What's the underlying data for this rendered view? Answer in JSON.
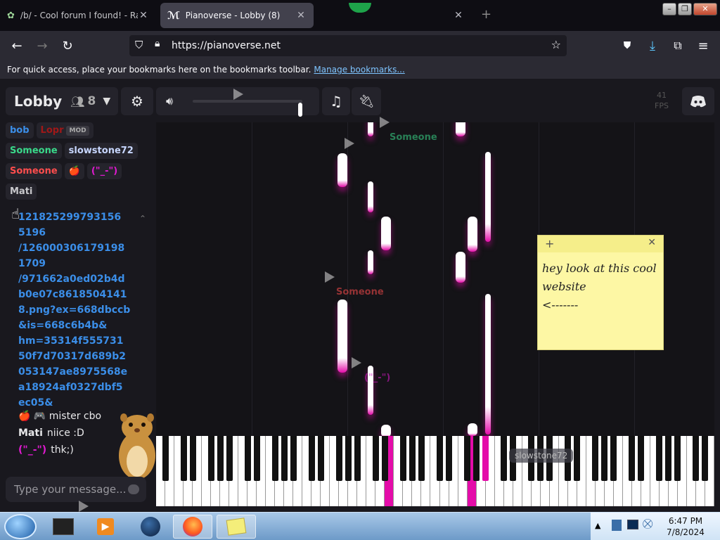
{
  "browser": {
    "tabs": [
      {
        "title": "/b/ - Cool forum I found! - Ran",
        "active": false
      },
      {
        "title": "Pianoverse - Lobby (8)",
        "active": true
      },
      {
        "title": "",
        "active": false
      }
    ],
    "url": "https://pianoverse.net",
    "bookmarks_hint": "For quick access, place your bookmarks here on the bookmarks toolbar.",
    "bookmarks_link": "Manage bookmarks..."
  },
  "topbar": {
    "lobby_name": "Lobby",
    "user_count": "8",
    "fps_value": "41",
    "fps_label": "FPS"
  },
  "users": [
    {
      "name": "bob",
      "color": "#3b8ee8"
    },
    {
      "name": "Lopr",
      "color": "#a01818",
      "tag": "MOD"
    },
    {
      "name": "Someone",
      "color": "#39d98a"
    },
    {
      "name": "slowstone72",
      "color": "#c8d7ff"
    },
    {
      "name": "Someone",
      "color": "#ff4d4d"
    },
    {
      "name": "🍎",
      "color": "#ff4d4d"
    },
    {
      "name": "(\"_-\")",
      "color": "#e01ad0"
    },
    {
      "name": "Mati",
      "color": "#c8c8cc"
    }
  ],
  "chat": {
    "link_lines": [
      "121825299793156",
      "5196",
      "/126000306179198",
      "1709",
      "/971662a0ed02b4d",
      "b0e07c8618504141",
      "8.png?ex=668dbccb",
      "&is=668c6b4b&",
      "hm=35314f555731",
      "50f7d70317d689b2",
      "053147ae8975568e",
      "a18924af0327dbf5",
      "ec05&"
    ],
    "messages": [
      {
        "name": "🍎 🎮 mister cbo",
        "text": "",
        "color": "#e8e8ea"
      },
      {
        "name": "Mati",
        "text": "niice :D",
        "color": "#e8e8ea"
      },
      {
        "name": "(\"_-\")",
        "text": "thk;)",
        "color": "#e01ad0"
      }
    ],
    "input_placeholder": "Type your message..."
  },
  "roll_cursors": [
    {
      "label": "Someone",
      "color": "#39d98a"
    },
    {
      "label": "Someone",
      "color": "#ff4d4d"
    },
    {
      "label": "(\"_-\")",
      "color": "#e01ad0"
    }
  ],
  "keyboard_label": "slowstone72",
  "sticky_note": {
    "lines": [
      "hey look at this cool",
      "website",
      "<-------"
    ]
  },
  "taskbar": {
    "time": "6:47 PM",
    "date": "7/8/2024"
  },
  "colors": {
    "accent_pink": "#e40ca9",
    "link_blue": "#3b8ee8",
    "bg_dark": "#19181e"
  }
}
